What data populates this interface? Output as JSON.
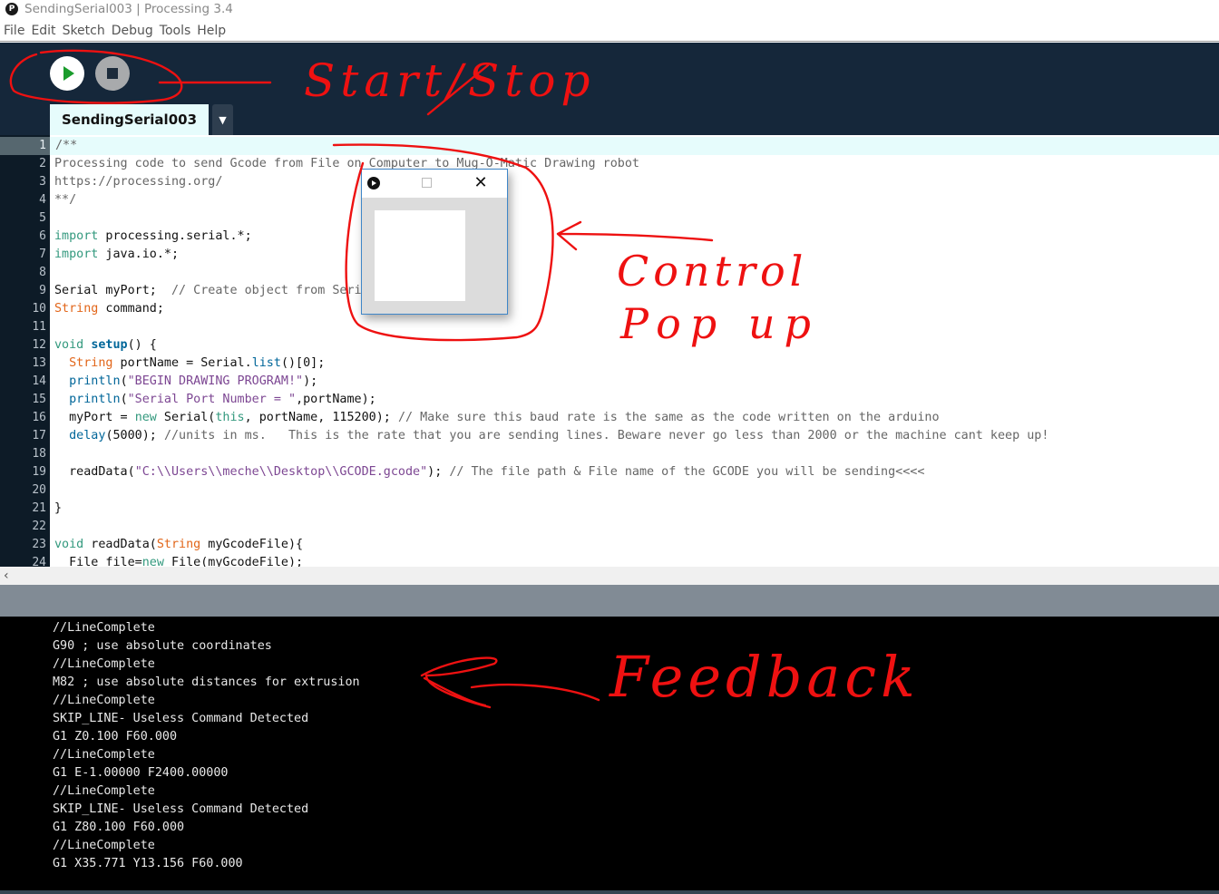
{
  "window": {
    "title": "SendingSerial003 | Processing 3.4",
    "app_icon": "processing-logo-icon",
    "app_icon_glyph": "P"
  },
  "menubar": {
    "items": [
      "File",
      "Edit",
      "Sketch",
      "Debug",
      "Tools",
      "Help"
    ]
  },
  "toolbar": {
    "run_button": {
      "icon": "play-icon",
      "label": "Run"
    },
    "stop_button": {
      "icon": "stop-icon",
      "label": "Stop"
    },
    "accent_play": "#1a9c2c"
  },
  "tabs": {
    "active": "SendingSerial003",
    "menu_glyph": "▼"
  },
  "editor": {
    "current_line": 1,
    "lines": [
      {
        "n": "1",
        "tokens": [
          [
            "com",
            "/**"
          ]
        ]
      },
      {
        "n": "2",
        "tokens": [
          [
            "com",
            "Processing code to send Gcode from File on Computer to Mug-O-Matic Drawing robot"
          ]
        ]
      },
      {
        "n": "3",
        "tokens": [
          [
            "com",
            "https://processing.org/"
          ]
        ]
      },
      {
        "n": "4",
        "tokens": [
          [
            "com",
            "**/"
          ]
        ]
      },
      {
        "n": "5",
        "tokens": []
      },
      {
        "n": "6",
        "tokens": [
          [
            "kw",
            "import"
          ],
          [
            "",
            " processing.serial.*;"
          ]
        ]
      },
      {
        "n": "7",
        "tokens": [
          [
            "kw",
            "import"
          ],
          [
            "",
            " java.io.*;"
          ]
        ]
      },
      {
        "n": "8",
        "tokens": []
      },
      {
        "n": "9",
        "tokens": [
          [
            "",
            "Serial myPort;  "
          ],
          [
            "com",
            "// Create object from Serial class"
          ]
        ]
      },
      {
        "n": "10",
        "tokens": [
          [
            "type",
            "String"
          ],
          [
            "",
            " command;"
          ]
        ]
      },
      {
        "n": "11",
        "tokens": []
      },
      {
        "n": "12",
        "tokens": [
          [
            "kw",
            "void"
          ],
          [
            "",
            " "
          ],
          [
            "fnb",
            "setup"
          ],
          [
            "",
            "() {"
          ]
        ]
      },
      {
        "n": "13",
        "tokens": [
          [
            "",
            "  "
          ],
          [
            "type",
            "String"
          ],
          [
            "",
            " portName = Serial."
          ],
          [
            "fn",
            "list"
          ],
          [
            "",
            "()[0];"
          ]
        ]
      },
      {
        "n": "14",
        "tokens": [
          [
            "",
            "  "
          ],
          [
            "fn",
            "println"
          ],
          [
            "",
            "("
          ],
          [
            "str",
            "\"BEGIN DRAWING PROGRAM!\""
          ],
          [
            "",
            ");"
          ]
        ]
      },
      {
        "n": "15",
        "tokens": [
          [
            "",
            "  "
          ],
          [
            "fn",
            "println"
          ],
          [
            "",
            "("
          ],
          [
            "str",
            "\"Serial Port Number = \""
          ],
          [
            "",
            ",portName);"
          ]
        ]
      },
      {
        "n": "16",
        "tokens": [
          [
            "",
            "  myPort = "
          ],
          [
            "kw",
            "new"
          ],
          [
            "",
            " Serial("
          ],
          [
            "lit",
            "this"
          ],
          [
            "",
            ", portName, 115200); "
          ],
          [
            "com",
            "// Make sure this baud rate is the same as the code written on the arduino"
          ]
        ]
      },
      {
        "n": "17",
        "tokens": [
          [
            "",
            "  "
          ],
          [
            "fn",
            "delay"
          ],
          [
            "",
            "(5000); "
          ],
          [
            "com",
            "//units in ms.   This is the rate that you are sending lines. Beware never go less than 2000 or the machine cant keep up!"
          ]
        ]
      },
      {
        "n": "18",
        "tokens": []
      },
      {
        "n": "19",
        "tokens": [
          [
            "",
            "  readData("
          ],
          [
            "str",
            "\"C:\\\\Users\\\\meche\\\\Desktop\\\\GCODE.gcode\""
          ],
          [
            "",
            "); "
          ],
          [
            "com",
            "// The file path & File name of the GCODE you will be sending<<<<"
          ]
        ]
      },
      {
        "n": "20",
        "tokens": []
      },
      {
        "n": "21",
        "tokens": [
          [
            "",
            "}"
          ]
        ]
      },
      {
        "n": "22",
        "tokens": []
      },
      {
        "n": "23",
        "tokens": [
          [
            "kw",
            "void"
          ],
          [
            "",
            " readData("
          ],
          [
            "type",
            "String"
          ],
          [
            "",
            " myGcodeFile){"
          ]
        ]
      },
      {
        "n": "24",
        "tokens": [
          [
            "",
            "  File file="
          ],
          [
            "kw",
            "new"
          ],
          [
            "",
            " File(myGcodeFile);"
          ]
        ]
      }
    ]
  },
  "scrollbar": {
    "left_glyph": "‹"
  },
  "console": {
    "lines": [
      "//LineComplete",
      "G90 ; use absolute coordinates",
      "//LineComplete",
      "M82 ; use absolute distances for extrusion",
      "//LineComplete",
      "SKIP_LINE- Useless Command Detected",
      "G1 Z0.100 F60.000",
      "//LineComplete",
      "G1 E-1.00000 F2400.00000",
      "//LineComplete",
      "SKIP_LINE- Useless Command Detected",
      "G1 Z80.100 F60.000",
      "//LineComplete",
      "G1 X35.771 Y13.156 F60.000"
    ]
  },
  "popup": {
    "icon": "processing-run-icon",
    "maximize_icon": "maximize-icon",
    "close_glyph": "✕"
  },
  "annotations": {
    "color": "#ee1111",
    "start_stop": "Start/Stop",
    "control_popup_line1": "Control",
    "control_popup_line2": "Pop up",
    "feedback": "Feedback"
  }
}
